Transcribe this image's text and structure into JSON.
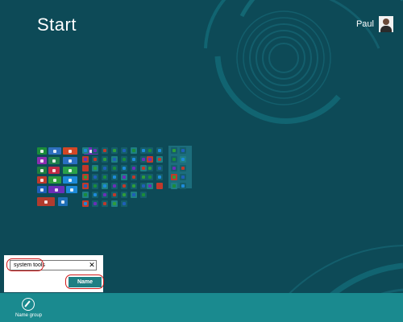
{
  "screen": {
    "title": "Start"
  },
  "user": {
    "name": "Paul"
  },
  "colors": {
    "background": "#0d4a57",
    "accent": "#1a8a8f",
    "highlight": "#d11a1a"
  },
  "tiles": [
    {
      "name": "store-tile",
      "color": "#1b8c3a",
      "icon": "store-icon"
    },
    {
      "name": "mail-tile",
      "color": "#2e6fbf",
      "icon": "mail-icon"
    },
    {
      "name": "people-tile",
      "color": "#d24726",
      "icon": "people-icon"
    },
    {
      "name": "music-tile",
      "color": "#8c2eb0",
      "icon": "headphones-icon"
    },
    {
      "name": "calculator-tile",
      "color": "#20824e",
      "icon": "calculator-icon"
    },
    {
      "name": "ie-tile",
      "color": "#2a6ec2",
      "icon": "ie-icon"
    },
    {
      "name": "excel-tile",
      "color": "#1f7f3e",
      "icon": "excel-icon"
    },
    {
      "name": "photos-tile",
      "color": "#c12b45",
      "icon": "photos-icon"
    },
    {
      "name": "messaging-tile",
      "color": "#2aa149",
      "icon": "messaging-icon"
    },
    {
      "name": "video-tile",
      "color": "#c0392b",
      "icon": "video-icon"
    },
    {
      "name": "games-tile",
      "color": "#2e9c3b",
      "icon": "games-icon"
    },
    {
      "name": "weather-tile",
      "color": "#1d8ad9",
      "icon": "weather-icon"
    },
    {
      "name": "word-tile",
      "color": "#1f5fb8",
      "icon": "word-icon"
    },
    {
      "name": "settings-tile",
      "color": "#6c2eb8",
      "icon": "gear-icon"
    },
    {
      "name": "travel-tile",
      "color": "#1d8ad9",
      "icon": "travel-icon"
    },
    {
      "name": "news-tile",
      "color": "#b13b2e",
      "icon": "news-icon"
    },
    {
      "name": "desktop-tile",
      "color": "#1f6fb6",
      "icon": "desktop-icon"
    },
    {
      "name": "maps-tile",
      "color": "#6c2eb8",
      "icon": "maps-icon"
    }
  ],
  "dialog": {
    "input_value": "system tools",
    "clear_icon": "close-icon",
    "button_label": "Name"
  },
  "app_bar": {
    "button_label": "Name group",
    "button_icon": "pencil-icon"
  }
}
